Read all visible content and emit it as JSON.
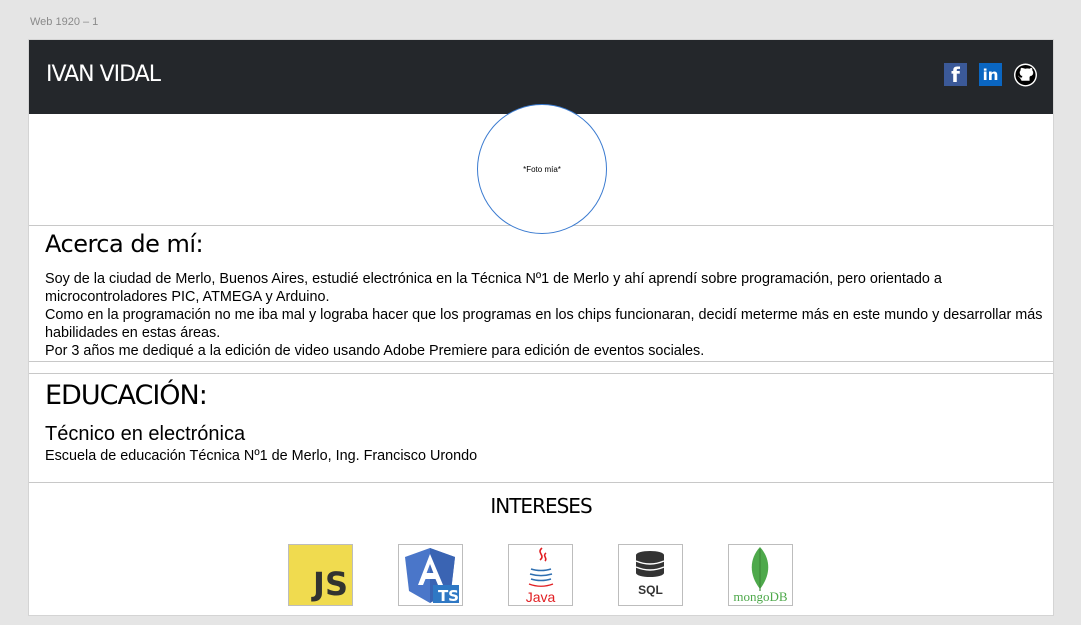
{
  "frame_label": "Web 1920 – 1",
  "header": {
    "name": "IVAN VIDAL",
    "social": [
      {
        "icon": "facebook-icon",
        "glyph": "f",
        "color": "#3b5998"
      },
      {
        "icon": "linkedin-icon",
        "glyph": "in",
        "color": "#0a66c2"
      },
      {
        "icon": "github-icon",
        "color": "#000000"
      }
    ]
  },
  "photo": {
    "placeholder": "*Foto mía*"
  },
  "about": {
    "heading": "Acerca de mí:",
    "paragraphs": [
      "Soy de la ciudad de Merlo, Buenos Aires, estudié electrónica en la Técnica Nº1 de Merlo y ahí aprendí sobre programación, pero orientado a microcontroladores  PIC, ATMEGA  y Arduino.",
      "Como en la programación no me iba mal y lograba hacer que los programas en los chips funcionaran, decidí meterme más en este mundo y  desarrollar más habilidades en estas áreas.",
      "Por 3 años me dediqué a la edición de video usando Adobe Premiere para edición de eventos sociales."
    ]
  },
  "education": {
    "heading": "EDUCACIÓN:",
    "title": "Técnico en electrónica",
    "school": "Escuela de educación Técnica Nº1 de Merlo, Ing. Francisco Urondo"
  },
  "interests": {
    "heading": "INTERESES",
    "items": [
      {
        "icon": "javascript-icon",
        "label": "JS"
      },
      {
        "icon": "angular-typescript-icon",
        "label": "TS"
      },
      {
        "icon": "java-icon",
        "label": "Java"
      },
      {
        "icon": "sql-database-icon",
        "label": "SQL"
      },
      {
        "icon": "mongodb-icon",
        "label": "mongoDB"
      }
    ]
  }
}
